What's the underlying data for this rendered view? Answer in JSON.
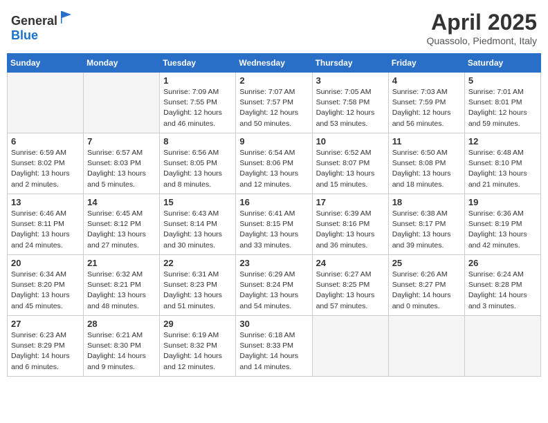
{
  "header": {
    "logo_general": "General",
    "logo_blue": "Blue",
    "title": "April 2025",
    "subtitle": "Quassolo, Piedmont, Italy"
  },
  "calendar": {
    "days_of_week": [
      "Sunday",
      "Monday",
      "Tuesday",
      "Wednesday",
      "Thursday",
      "Friday",
      "Saturday"
    ],
    "weeks": [
      [
        {
          "day": "",
          "info": ""
        },
        {
          "day": "",
          "info": ""
        },
        {
          "day": "1",
          "info": "Sunrise: 7:09 AM\nSunset: 7:55 PM\nDaylight: 12 hours and 46 minutes."
        },
        {
          "day": "2",
          "info": "Sunrise: 7:07 AM\nSunset: 7:57 PM\nDaylight: 12 hours and 50 minutes."
        },
        {
          "day": "3",
          "info": "Sunrise: 7:05 AM\nSunset: 7:58 PM\nDaylight: 12 hours and 53 minutes."
        },
        {
          "day": "4",
          "info": "Sunrise: 7:03 AM\nSunset: 7:59 PM\nDaylight: 12 hours and 56 minutes."
        },
        {
          "day": "5",
          "info": "Sunrise: 7:01 AM\nSunset: 8:01 PM\nDaylight: 12 hours and 59 minutes."
        }
      ],
      [
        {
          "day": "6",
          "info": "Sunrise: 6:59 AM\nSunset: 8:02 PM\nDaylight: 13 hours and 2 minutes."
        },
        {
          "day": "7",
          "info": "Sunrise: 6:57 AM\nSunset: 8:03 PM\nDaylight: 13 hours and 5 minutes."
        },
        {
          "day": "8",
          "info": "Sunrise: 6:56 AM\nSunset: 8:05 PM\nDaylight: 13 hours and 8 minutes."
        },
        {
          "day": "9",
          "info": "Sunrise: 6:54 AM\nSunset: 8:06 PM\nDaylight: 13 hours and 12 minutes."
        },
        {
          "day": "10",
          "info": "Sunrise: 6:52 AM\nSunset: 8:07 PM\nDaylight: 13 hours and 15 minutes."
        },
        {
          "day": "11",
          "info": "Sunrise: 6:50 AM\nSunset: 8:08 PM\nDaylight: 13 hours and 18 minutes."
        },
        {
          "day": "12",
          "info": "Sunrise: 6:48 AM\nSunset: 8:10 PM\nDaylight: 13 hours and 21 minutes."
        }
      ],
      [
        {
          "day": "13",
          "info": "Sunrise: 6:46 AM\nSunset: 8:11 PM\nDaylight: 13 hours and 24 minutes."
        },
        {
          "day": "14",
          "info": "Sunrise: 6:45 AM\nSunset: 8:12 PM\nDaylight: 13 hours and 27 minutes."
        },
        {
          "day": "15",
          "info": "Sunrise: 6:43 AM\nSunset: 8:14 PM\nDaylight: 13 hours and 30 minutes."
        },
        {
          "day": "16",
          "info": "Sunrise: 6:41 AM\nSunset: 8:15 PM\nDaylight: 13 hours and 33 minutes."
        },
        {
          "day": "17",
          "info": "Sunrise: 6:39 AM\nSunset: 8:16 PM\nDaylight: 13 hours and 36 minutes."
        },
        {
          "day": "18",
          "info": "Sunrise: 6:38 AM\nSunset: 8:17 PM\nDaylight: 13 hours and 39 minutes."
        },
        {
          "day": "19",
          "info": "Sunrise: 6:36 AM\nSunset: 8:19 PM\nDaylight: 13 hours and 42 minutes."
        }
      ],
      [
        {
          "day": "20",
          "info": "Sunrise: 6:34 AM\nSunset: 8:20 PM\nDaylight: 13 hours and 45 minutes."
        },
        {
          "day": "21",
          "info": "Sunrise: 6:32 AM\nSunset: 8:21 PM\nDaylight: 13 hours and 48 minutes."
        },
        {
          "day": "22",
          "info": "Sunrise: 6:31 AM\nSunset: 8:23 PM\nDaylight: 13 hours and 51 minutes."
        },
        {
          "day": "23",
          "info": "Sunrise: 6:29 AM\nSunset: 8:24 PM\nDaylight: 13 hours and 54 minutes."
        },
        {
          "day": "24",
          "info": "Sunrise: 6:27 AM\nSunset: 8:25 PM\nDaylight: 13 hours and 57 minutes."
        },
        {
          "day": "25",
          "info": "Sunrise: 6:26 AM\nSunset: 8:27 PM\nDaylight: 14 hours and 0 minutes."
        },
        {
          "day": "26",
          "info": "Sunrise: 6:24 AM\nSunset: 8:28 PM\nDaylight: 14 hours and 3 minutes."
        }
      ],
      [
        {
          "day": "27",
          "info": "Sunrise: 6:23 AM\nSunset: 8:29 PM\nDaylight: 14 hours and 6 minutes."
        },
        {
          "day": "28",
          "info": "Sunrise: 6:21 AM\nSunset: 8:30 PM\nDaylight: 14 hours and 9 minutes."
        },
        {
          "day": "29",
          "info": "Sunrise: 6:19 AM\nSunset: 8:32 PM\nDaylight: 14 hours and 12 minutes."
        },
        {
          "day": "30",
          "info": "Sunrise: 6:18 AM\nSunset: 8:33 PM\nDaylight: 14 hours and 14 minutes."
        },
        {
          "day": "",
          "info": ""
        },
        {
          "day": "",
          "info": ""
        },
        {
          "day": "",
          "info": ""
        }
      ]
    ]
  }
}
